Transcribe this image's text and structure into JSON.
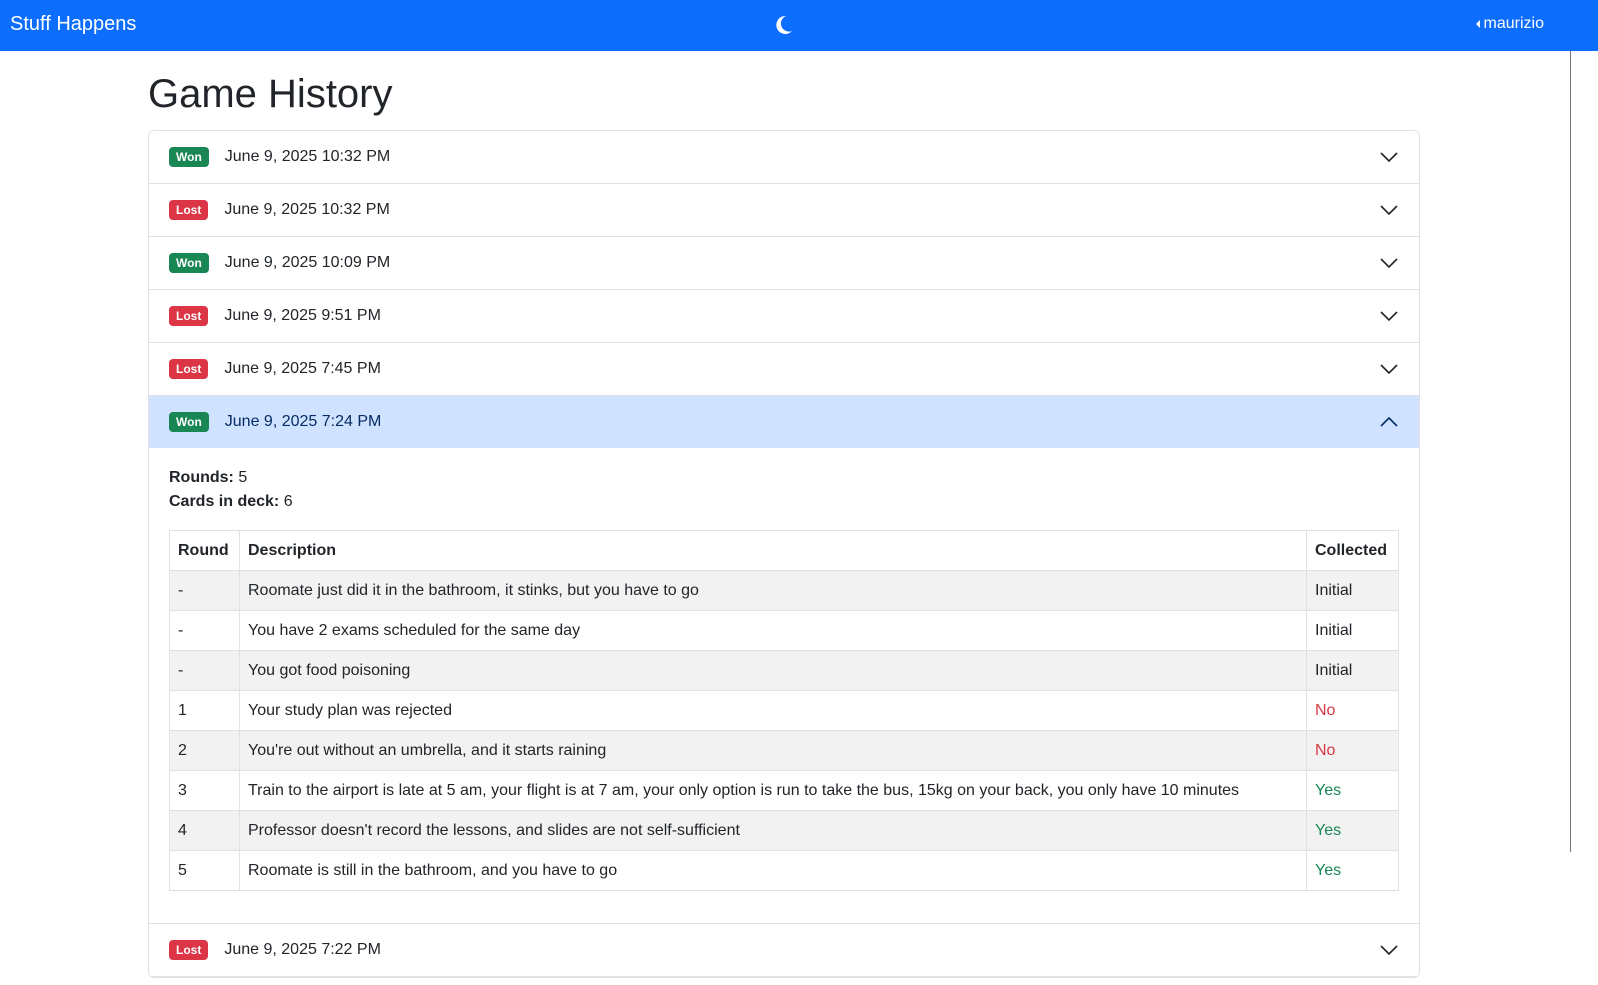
{
  "navbar": {
    "brand": "Stuff Happens",
    "theme_icon": "moon-icon",
    "user": "maurizio"
  },
  "page": {
    "title": "Game History"
  },
  "colors": {
    "primary": "#0d6efd",
    "won": "#198754",
    "lost": "#dc3545",
    "open_header": "#cfe2ff"
  },
  "games": [
    {
      "result": "Won",
      "date": "June 9, 2025 10:32 PM"
    },
    {
      "result": "Lost",
      "date": "June 9, 2025 10:32 PM"
    },
    {
      "result": "Won",
      "date": "June 9, 2025 10:09 PM"
    },
    {
      "result": "Lost",
      "date": "June 9, 2025 9:51 PM"
    },
    {
      "result": "Lost",
      "date": "June 9, 2025 7:45 PM"
    },
    {
      "result": "Won",
      "date": "June 9, 2025 7:24 PM"
    },
    {
      "result": "Lost",
      "date": "June 9, 2025 7:22 PM"
    }
  ],
  "open_game": {
    "rounds_label": "Rounds:",
    "rounds_value": "5",
    "cards_label": "Cards in deck:",
    "cards_value": "6",
    "table": {
      "headers": [
        "Round",
        "Description",
        "Collected"
      ],
      "rows": [
        {
          "round": "-",
          "description": "Roomate just did it in the bathroom, it stinks, but you have to go",
          "collected": "Initial"
        },
        {
          "round": "-",
          "description": "You have 2 exams scheduled for the same day",
          "collected": "Initial"
        },
        {
          "round": "-",
          "description": "You got food poisoning",
          "collected": "Initial"
        },
        {
          "round": "1",
          "description": "Your study plan was rejected",
          "collected": "No"
        },
        {
          "round": "2",
          "description": "You're out without an umbrella, and it starts raining",
          "collected": "No"
        },
        {
          "round": "3",
          "description": "Train to the airport is late at 5 am, your flight is at 7 am, your only option is run to take the bus, 15kg on your back, you only have 10 minutes",
          "collected": "Yes"
        },
        {
          "round": "4",
          "description": "Professor doesn't record the lessons, and slides are not self-sufficient",
          "collected": "Yes"
        },
        {
          "round": "5",
          "description": "Roomate is still in the bathroom, and you have to go",
          "collected": "Yes"
        }
      ]
    }
  }
}
